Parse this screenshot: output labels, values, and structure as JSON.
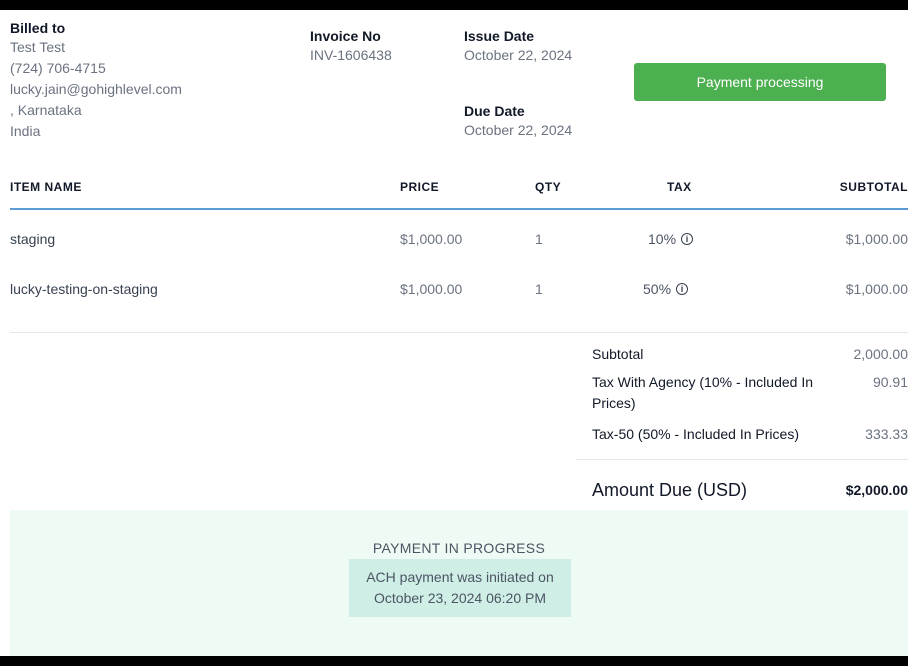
{
  "billed_to": {
    "label": "Billed to",
    "name": "Test Test",
    "phone": "(724) 706-4715",
    "email": "lucky.jain@gohighlevel.com",
    "region": ", Karnataka",
    "country": "India"
  },
  "invoice": {
    "no_label": "Invoice No",
    "no_value": "INV-1606438",
    "issue_label": "Issue Date",
    "issue_value": "October 22, 2024",
    "due_label": "Due Date",
    "due_value": "October 22, 2024"
  },
  "status_button": {
    "label": "Payment processing",
    "color": "#4caf50"
  },
  "table": {
    "headers": {
      "item": "ITEM NAME",
      "price": "PRICE",
      "qty": "QTY",
      "tax": "TAX",
      "subtotal": "SUBTOTAL"
    },
    "rows": [
      {
        "item": "staging",
        "price": "$1,000.00",
        "qty": "1",
        "tax": "10%",
        "subtotal": "$1,000.00"
      },
      {
        "item": "lucky-testing-on-staging",
        "price": "$1,000.00",
        "qty": "1",
        "tax": "50%",
        "subtotal": "$1,000.00"
      }
    ]
  },
  "totals": {
    "subtotal_label": "Subtotal",
    "subtotal_value": "2,000.00",
    "tax1_label": "Tax With Agency (10% - Included In Prices)",
    "tax1_value": "90.91",
    "tax2_label": "Tax-50 (50% - Included In Prices)",
    "tax2_value": "333.33",
    "amount_due_label": "Amount Due (USD)",
    "amount_due_value": "$2,000.00"
  },
  "footer": {
    "title": "PAYMENT IN PROGRESS",
    "line1": "ACH payment was initiated on",
    "line2": "October 23, 2024 06:20 PM"
  }
}
